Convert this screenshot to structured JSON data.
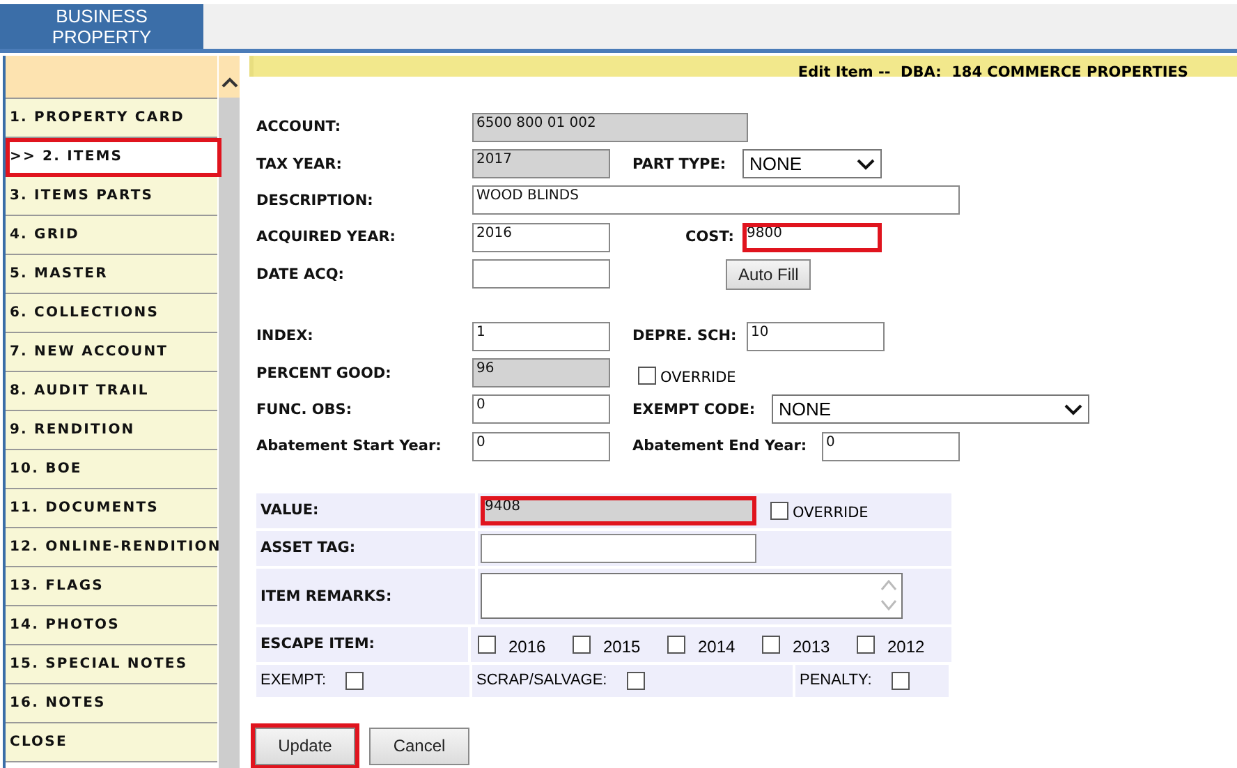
{
  "header": {
    "title": "BUSINESS PROPERTY"
  },
  "sidebar": {
    "items": [
      {
        "label": "1. PROPERTY CARD",
        "selected": false
      },
      {
        "label": ">> 2. ITEMS",
        "selected": true
      },
      {
        "label": "3. ITEMS PARTS",
        "selected": false
      },
      {
        "label": "4. GRID",
        "selected": false
      },
      {
        "label": "5. MASTER",
        "selected": false
      },
      {
        "label": "6. COLLECTIONS",
        "selected": false
      },
      {
        "label": "7. NEW ACCOUNT",
        "selected": false
      },
      {
        "label": "8. AUDIT TRAIL",
        "selected": false
      },
      {
        "label": "9. RENDITION",
        "selected": false
      },
      {
        "label": "10. BOE",
        "selected": false
      },
      {
        "label": "11. DOCUMENTS",
        "selected": false
      },
      {
        "label": "12. ONLINE-RENDITION",
        "selected": false
      },
      {
        "label": "13. FLAGS",
        "selected": false
      },
      {
        "label": "14. PHOTOS",
        "selected": false
      },
      {
        "label": "15. SPECIAL NOTES",
        "selected": false
      },
      {
        "label": "16. NOTES",
        "selected": false
      },
      {
        "label": "CLOSE",
        "selected": false
      }
    ]
  },
  "form_title": "Edit Item --  DBA:  184 COMMERCE PROPERTIES",
  "groups": [
    [
      {
        "left": {
          "label": "ACCOUNT:",
          "kind": "text",
          "value": "6500 800 01 002",
          "readonly": true,
          "highlighted": false
        }
      },
      {
        "left": {
          "label": "TAX YEAR:",
          "kind": "text",
          "value": "2017",
          "readonly": true,
          "highlighted": false
        },
        "right": {
          "label": "PART TYPE:",
          "kind": "select",
          "value": "NONE"
        }
      },
      {
        "left": {
          "label": "DESCRIPTION:",
          "kind": "text",
          "value": "WOOD BLINDS",
          "readonly": false,
          "highlighted": false
        }
      },
      {
        "left": {
          "label": "ACQUIRED YEAR:",
          "kind": "text",
          "value": "2016",
          "readonly": false,
          "highlighted": false
        },
        "right": {
          "label": "COST:",
          "kind": "text",
          "value": "9800",
          "readonly": false,
          "highlighted": true
        }
      },
      {
        "left": {
          "label": "DATE ACQ:",
          "kind": "text",
          "readonly": false,
          "highlighted": false
        },
        "right": {
          "kind": "button",
          "label": "Auto Fill"
        }
      }
    ],
    [
      {
        "left": {
          "label": "INDEX:",
          "kind": "text",
          "value": "1",
          "readonly": false,
          "highlighted": false
        },
        "right": {
          "label": "DEPRE. SCH:",
          "kind": "text",
          "value": "10",
          "readonly": false,
          "highlighted": false
        }
      },
      {
        "left": {
          "label": "PERCENT GOOD:",
          "kind": "text",
          "value": "96",
          "readonly": true,
          "highlighted": false
        },
        "right": {
          "kind": "checkbox",
          "label": "OVERRIDE",
          "checked": false
        }
      },
      {
        "left": {
          "label": "FUNC. OBS:",
          "kind": "text",
          "value": "0",
          "readonly": false,
          "highlighted": false
        },
        "right": {
          "label": "EXEMPT CODE:",
          "kind": "select",
          "value": "NONE"
        }
      },
      {
        "left": {
          "label": "Abatement Start Year:",
          "kind": "text",
          "value": "0",
          "readonly": false,
          "highlighted": false
        },
        "right": {
          "label": "Abatement End Year:",
          "kind": "text",
          "value": "0",
          "readonly": false,
          "highlighted": false
        }
      }
    ]
  ],
  "details": {
    "value": {
      "label": "VALUE:",
      "value": "9408",
      "readonly": true,
      "highlighted": true,
      "override": {
        "label": "OVERRIDE",
        "checked": false
      }
    },
    "asset_tag": {
      "label": "ASSET TAG:"
    },
    "item_remarks": {
      "label": "ITEM REMARKS:"
    },
    "escape_item": {
      "label": "ESCAPE ITEM:",
      "years": [
        {
          "label": "2016",
          "checked": false
        },
        {
          "label": "2015",
          "checked": false
        },
        {
          "label": "2014",
          "checked": false
        },
        {
          "label": "2013",
          "checked": false
        },
        {
          "label": "2012",
          "checked": false
        }
      ]
    },
    "flags": [
      {
        "label": "EXEMPT:",
        "checked": false
      },
      {
        "label": "SCRAP/SALVAGE:",
        "checked": false
      },
      {
        "label": "PENALTY:",
        "checked": false
      }
    ]
  },
  "buttons": [
    {
      "label": "Update",
      "highlighted": true
    },
    {
      "label": "Cancel",
      "highlighted": false
    }
  ]
}
